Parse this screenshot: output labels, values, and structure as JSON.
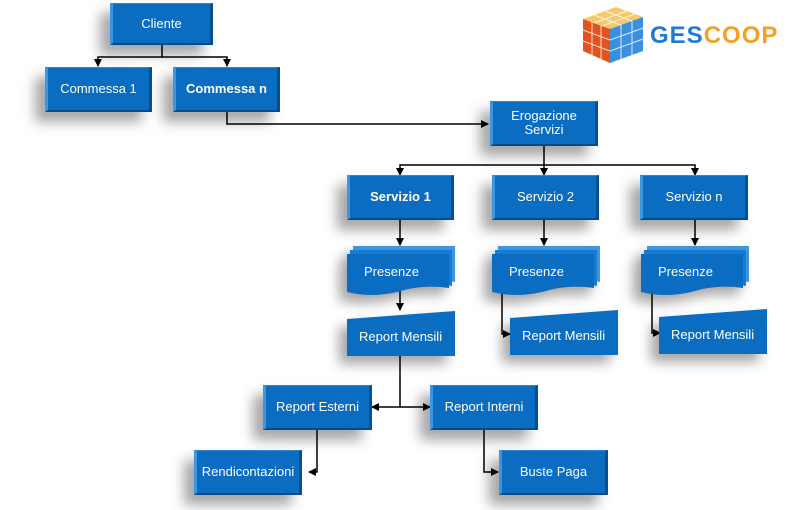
{
  "logo": {
    "part1": "GES",
    "part2": "COOP",
    "icon": "rubik-cube-icon"
  },
  "colors": {
    "box_fill": "#0a6dc2",
    "connector": "#000000",
    "logo_blue": "#1f7ad6",
    "logo_orange": "#f5a020"
  },
  "nodes": {
    "cliente": "Cliente",
    "commessa_1": "Commessa 1",
    "commessa_n": "Commessa n",
    "erogazione_line1": "Erogazione",
    "erogazione_line2": "Servizi",
    "servizio_1": "Servizio 1",
    "servizio_2": "Servizio 2",
    "servizio_n": "Servizio n",
    "presenze_1": "Presenze",
    "presenze_2": "Presenze",
    "presenze_n": "Presenze",
    "report_mensili_1": "Report Mensili",
    "report_mensili_2": "Report Mensili",
    "report_mensili_n": "Report Mensili",
    "report_esterni": "Report Esterni",
    "report_interni": "Report Interni",
    "rendicontazioni": "Rendicontazioni",
    "buste_paga": "Buste Paga"
  }
}
